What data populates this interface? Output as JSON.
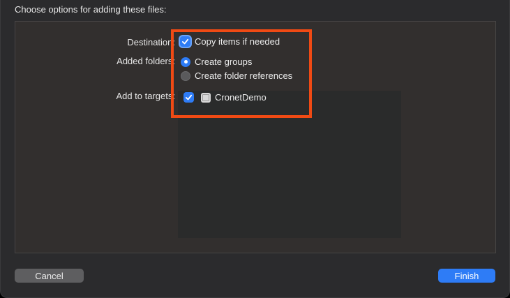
{
  "dialog": {
    "title": "Choose options for adding these files:"
  },
  "destination": {
    "label": "Destination:",
    "copy_items": {
      "label": "Copy items if needed",
      "checked": true
    }
  },
  "added_folders": {
    "label": "Added folders:",
    "options": [
      {
        "label": "Create groups",
        "selected": true
      },
      {
        "label": "Create folder references",
        "selected": false
      }
    ]
  },
  "targets": {
    "label": "Add to targets:",
    "items": [
      {
        "name": "CronetDemo",
        "checked": true
      }
    ]
  },
  "buttons": {
    "cancel": "Cancel",
    "finish": "Finish"
  },
  "colors": {
    "accent": "#2e7cf6",
    "highlight": "#f04a14"
  }
}
